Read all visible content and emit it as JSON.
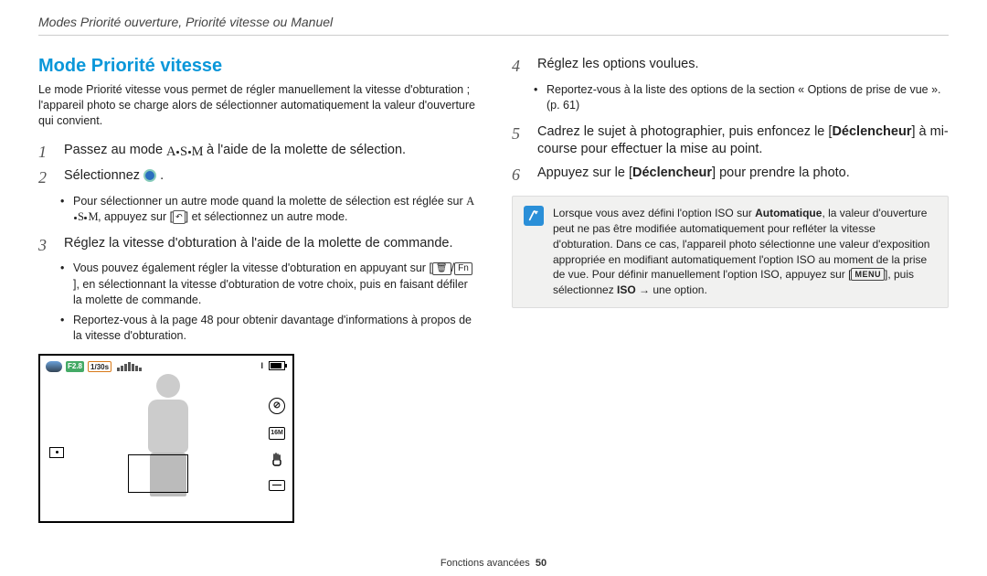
{
  "header": {
    "breadcrumb": "Modes Priorité ouverture, Priorité vitesse ou Manuel"
  },
  "section": {
    "title": "Mode Priorité vitesse",
    "intro": "Le mode Priorité vitesse vous permet de régler manuellement la vitesse d'obturation ; l'appareil photo se charge alors de sélectionner automatiquement la valeur d'ouverture qui convient."
  },
  "steps": {
    "s1": {
      "num": "1",
      "text_a": "Passez au mode ",
      "text_b": " à l'aide de la molette de sélection."
    },
    "s2": {
      "num": "2",
      "text_a": "Sélectionnez ",
      "text_b": " .",
      "bullets": [
        {
          "a": "Pour sélectionner un autre mode quand la molette de sélection est réglée sur ",
          "b": ", appuyez sur [",
          "c": "] et sélectionnez un autre mode."
        }
      ]
    },
    "s3": {
      "num": "3",
      "text": "Réglez la vitesse d'obturation à l'aide de la molette de commande.",
      "bullets": [
        "Vous pouvez également régler la vitesse d'obturation en appuyant sur [    /   ], en sélectionnant la vitesse d'obturation de votre choix, puis en faisant défiler la molette de commande.",
        "Reportez-vous à la page 48 pour obtenir davantage d'informations à propos de la vitesse d'obturation."
      ],
      "key_left": "🗑",
      "key_right": "Fn"
    },
    "s4": {
      "num": "4",
      "text": "Réglez les options voulues.",
      "bullets": [
        "Reportez-vous à la liste des options de la section « Options de prise de vue ». (p. 61)"
      ]
    },
    "s5": {
      "num": "5",
      "text_a": "Cadrez le sujet à photographier, puis enfoncez le [",
      "bold": "Déclencheur",
      "text_b": "] à mi-course pour effectuer la mise au point."
    },
    "s6": {
      "num": "6",
      "text_a": "Appuyez sur le [",
      "bold": "Déclencheur",
      "text_b": "] pour prendre la photo."
    }
  },
  "note": {
    "a": "Lorsque vous avez défini l'option ISO sur ",
    "auto": "Automatique",
    "b": ", la valeur d'ouverture peut ne pas être modifiée automatiquement pour refléter la vitesse d'obturation. Dans ce cas, l'appareil photo sélectionne une valeur d'exposition appropriée en modifiant automatiquement l'option ISO au moment de la prise de vue. Pour définir manuellement l'option ISO, appuyez sur [",
    "menu": "MENU",
    "c": "], puis sélectionnez ",
    "iso": "ISO",
    "d": " → une option."
  },
  "screenshot": {
    "aperture": "F2.8",
    "shutter": "1/30s",
    "right_box": "16M",
    "flash_char": "⊘"
  },
  "footer": {
    "label": "Fonctions avancées",
    "page": "50"
  }
}
